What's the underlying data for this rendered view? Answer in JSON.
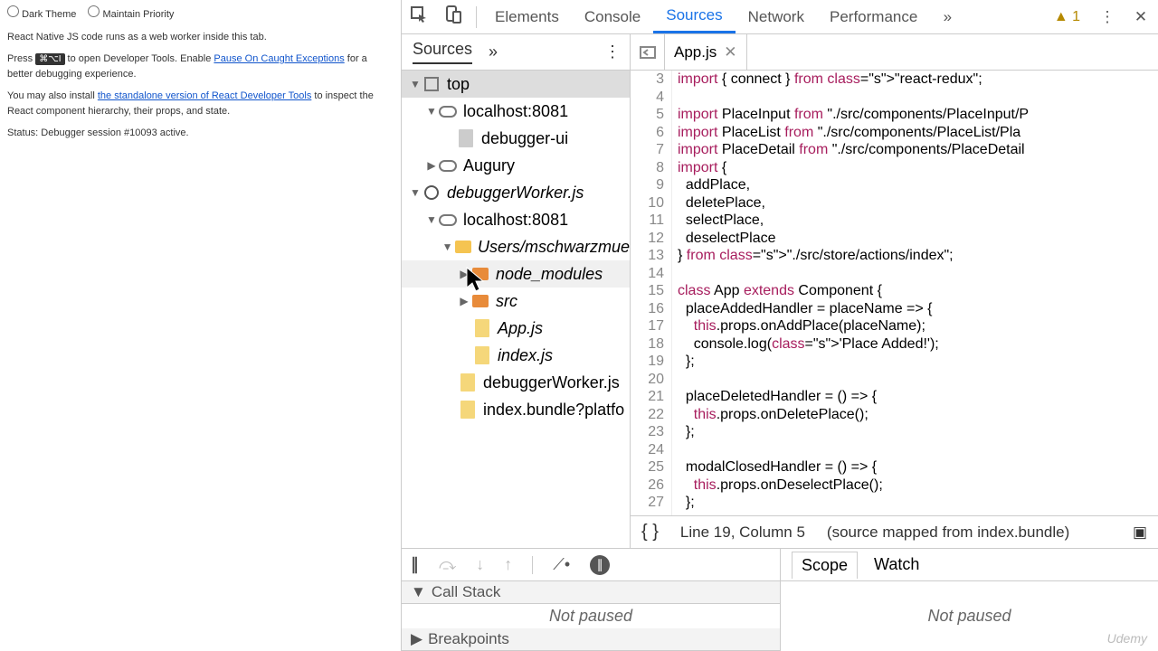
{
  "leftPanel": {
    "darkTheme": "Dark Theme",
    "maintainPriority": "Maintain Priority",
    "line1": "React Native JS code runs as a web worker inside this tab.",
    "line2a": "Press ",
    "kbd": "⌘⌥I",
    "line2b": " to open Developer Tools. Enable ",
    "pauseLink": "Pause On Caught Exceptions",
    "line2c": " for a better debugging experience.",
    "line3a": "You may also install ",
    "standaloneLink": "the standalone version of React Developer Tools",
    "line3b": " to inspect the React component hierarchy, their props, and state.",
    "status": "Status: Debugger session #10093 active."
  },
  "tabs": {
    "elements": "Elements",
    "console": "Console",
    "sources": "Sources",
    "network": "Network",
    "performance": "Performance"
  },
  "warnings": "1",
  "navTab": "Sources",
  "tree": {
    "top": "top",
    "host1": "localhost:8081",
    "debuggerUi": "debugger-ui",
    "augury": "Augury",
    "workerCtx": "debuggerWorker.js",
    "host2": "localhost:8081",
    "userPath": "Users/mschwarzmue",
    "nodeModules": "node_modules",
    "src": "src",
    "appjs": "App.js",
    "indexjs": "index.js",
    "dbgWorkerFile": "debuggerWorker.js",
    "bundle": "index.bundle?platfo"
  },
  "openFile": "App.js",
  "gutterStart": 3,
  "codeLines": [
    {
      "t": "import { connect } from \"react-redux\";",
      "ln": 3
    },
    {
      "t": "",
      "ln": 4
    },
    {
      "t": "import PlaceInput from \"./src/components/PlaceInput/P",
      "ln": 5
    },
    {
      "t": "import PlaceList from \"./src/components/PlaceList/Pla",
      "ln": 6
    },
    {
      "t": "import PlaceDetail from \"./src/components/PlaceDetail",
      "ln": 7
    },
    {
      "t": "import {",
      "ln": 8
    },
    {
      "t": "  addPlace,",
      "ln": 9
    },
    {
      "t": "  deletePlace,",
      "ln": 10
    },
    {
      "t": "  selectPlace,",
      "ln": 11
    },
    {
      "t": "  deselectPlace",
      "ln": 12
    },
    {
      "t": "} from \"./src/store/actions/index\";",
      "ln": 13
    },
    {
      "t": "",
      "ln": 14
    },
    {
      "t": "class App extends Component {",
      "ln": 15
    },
    {
      "t": "  placeAddedHandler = placeName => {",
      "ln": 16
    },
    {
      "t": "    this.props.onAddPlace(placeName);",
      "ln": 17
    },
    {
      "t": "    console.log('Place Added!');",
      "ln": 18
    },
    {
      "t": "  };",
      "ln": 19
    },
    {
      "t": "",
      "ln": 20
    },
    {
      "t": "  placeDeletedHandler = () => {",
      "ln": 21
    },
    {
      "t": "    this.props.onDeletePlace();",
      "ln": 22
    },
    {
      "t": "  };",
      "ln": 23
    },
    {
      "t": "",
      "ln": 24
    },
    {
      "t": "  modalClosedHandler = () => {",
      "ln": 25
    },
    {
      "t": "    this.props.onDeselectPlace();",
      "ln": 26
    },
    {
      "t": "  };",
      "ln": 27
    }
  ],
  "statusBar": {
    "pos": "Line 19, Column 5",
    "mapped": "(source mapped from index.bundle)"
  },
  "callStack": "Call Stack",
  "breakpoints": "Breakpoints",
  "notPaused": "Not paused",
  "scope": "Scope",
  "watch": "Watch",
  "watermark": "Udemy"
}
